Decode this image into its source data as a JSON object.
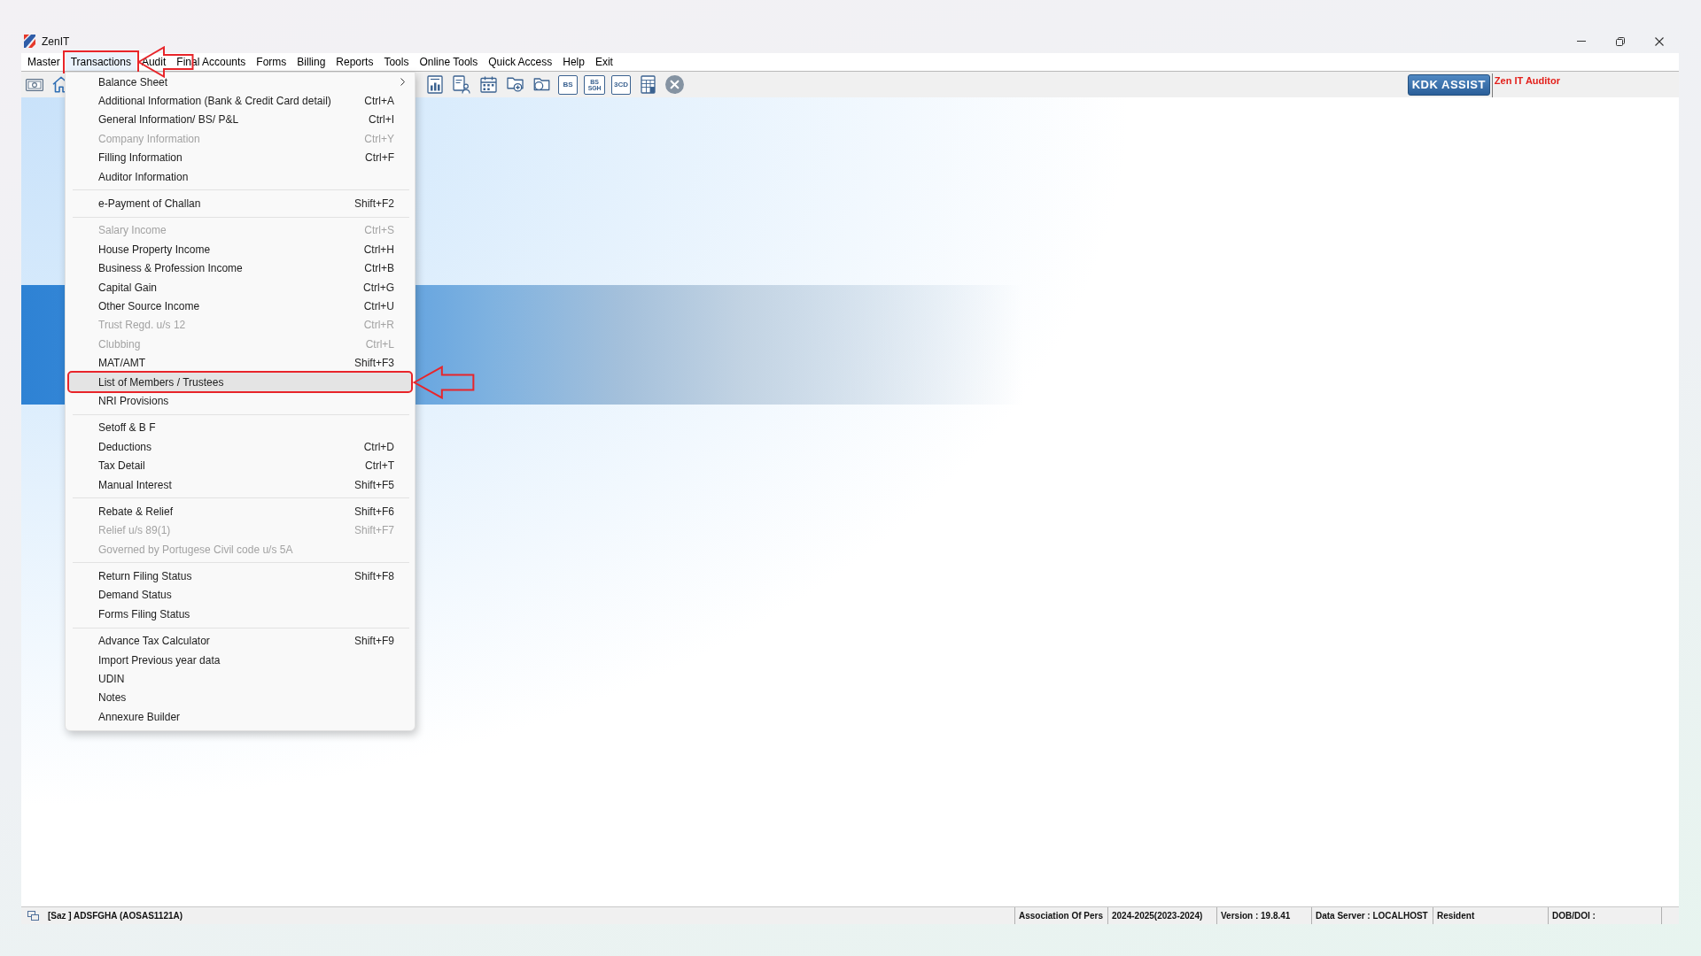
{
  "window": {
    "title": "ZenIT"
  },
  "menu_bar": [
    {
      "label": "Master",
      "selected": false,
      "callout": false
    },
    {
      "label": "Transactions",
      "selected": true,
      "callout": true
    },
    {
      "label": "Audit",
      "selected": false,
      "callout": false
    },
    {
      "label": "Final Accounts",
      "selected": false,
      "callout": false
    },
    {
      "label": "Forms",
      "selected": false,
      "callout": false
    },
    {
      "label": "Billing",
      "selected": false,
      "callout": false
    },
    {
      "label": "Reports",
      "selected": false,
      "callout": false
    },
    {
      "label": "Tools",
      "selected": false,
      "callout": false
    },
    {
      "label": "Online Tools",
      "selected": false,
      "callout": false
    },
    {
      "label": "Quick Access",
      "selected": false,
      "callout": false
    },
    {
      "label": "Help",
      "selected": false,
      "callout": false
    },
    {
      "label": "Exit",
      "selected": false,
      "callout": false
    }
  ],
  "toolbar": {
    "buttons": [
      {
        "kind": "banknote"
      },
      {
        "kind": "home"
      },
      {
        "kind": "chart-document"
      },
      {
        "kind": "user-document"
      },
      {
        "kind": "calendar"
      },
      {
        "kind": "folder-plus"
      },
      {
        "kind": "folder-circle"
      },
      {
        "kind": "text",
        "label": "BS"
      },
      {
        "kind": "text",
        "label": "BS",
        "sublabel": "SGH"
      },
      {
        "kind": "text",
        "label": "3CD"
      },
      {
        "kind": "spreadsheet"
      },
      {
        "kind": "close"
      }
    ],
    "assist_button": "KDK ASSIST",
    "product_label": "Zen IT Auditor"
  },
  "dropdown": {
    "groups": [
      [
        {
          "label": "Balance Sheet",
          "disabled": false,
          "selected": false,
          "callout": false,
          "submenu": true
        },
        {
          "label": "Additional Information (Bank & Credit Card detail)",
          "shortcut": "Ctrl+A",
          "disabled": false,
          "selected": false,
          "callout": false,
          "submenu": false
        },
        {
          "label": "General Information/ BS/ P&L",
          "shortcut": "Ctrl+I",
          "disabled": false,
          "selected": false,
          "callout": false,
          "submenu": false
        },
        {
          "label": "Company Information",
          "shortcut": "Ctrl+Y",
          "disabled": true,
          "selected": false,
          "callout": false,
          "submenu": false
        },
        {
          "label": "Filling Information",
          "shortcut": "Ctrl+F",
          "disabled": false,
          "selected": false,
          "callout": false,
          "submenu": false
        },
        {
          "label": "Auditor Information",
          "disabled": false,
          "selected": false,
          "callout": false,
          "submenu": false
        }
      ],
      [
        {
          "label": "e-Payment of Challan",
          "shortcut": "Shift+F2",
          "disabled": false,
          "selected": false,
          "callout": false,
          "submenu": false
        }
      ],
      [
        {
          "label": "Salary Income",
          "shortcut": "Ctrl+S",
          "disabled": true,
          "selected": false,
          "callout": false,
          "submenu": false
        },
        {
          "label": "House Property Income",
          "shortcut": "Ctrl+H",
          "disabled": false,
          "selected": false,
          "callout": false,
          "submenu": false
        },
        {
          "label": "Business & Profession Income",
          "shortcut": "Ctrl+B",
          "disabled": false,
          "selected": false,
          "callout": false,
          "submenu": false
        },
        {
          "label": "Capital Gain",
          "shortcut": "Ctrl+G",
          "disabled": false,
          "selected": false,
          "callout": false,
          "submenu": false
        },
        {
          "label": "Other Source Income",
          "shortcut": "Ctrl+U",
          "disabled": false,
          "selected": false,
          "callout": false,
          "submenu": false
        },
        {
          "label": "Trust Regd. u/s 12",
          "shortcut": "Ctrl+R",
          "disabled": true,
          "selected": false,
          "callout": false,
          "submenu": false
        },
        {
          "label": "Clubbing",
          "shortcut": "Ctrl+L",
          "disabled": true,
          "selected": false,
          "callout": false,
          "submenu": false
        },
        {
          "label": "MAT/AMT",
          "shortcut": "Shift+F3",
          "disabled": false,
          "selected": false,
          "callout": false,
          "submenu": false
        },
        {
          "label": "List of Members / Trustees",
          "disabled": false,
          "selected": true,
          "callout": true,
          "submenu": false
        },
        {
          "label": "NRI Provisions",
          "disabled": false,
          "selected": false,
          "callout": false,
          "submenu": false
        }
      ],
      [
        {
          "label": "Setoff & B F",
          "disabled": false,
          "selected": false,
          "callout": false,
          "submenu": false
        },
        {
          "label": "Deductions",
          "shortcut": "Ctrl+D",
          "disabled": false,
          "selected": false,
          "callout": false,
          "submenu": false
        },
        {
          "label": "Tax Detail",
          "shortcut": "Ctrl+T",
          "disabled": false,
          "selected": false,
          "callout": false,
          "submenu": false
        },
        {
          "label": "Manual Interest",
          "shortcut": "Shift+F5",
          "disabled": false,
          "selected": false,
          "callout": false,
          "submenu": false
        }
      ],
      [
        {
          "label": "Rebate & Relief",
          "shortcut": "Shift+F6",
          "disabled": false,
          "selected": false,
          "callout": false,
          "submenu": false
        },
        {
          "label": "Relief u/s 89(1)",
          "shortcut": "Shift+F7",
          "disabled": true,
          "selected": false,
          "callout": false,
          "submenu": false
        },
        {
          "label": "Governed by Portugese Civil code u/s 5A",
          "disabled": true,
          "selected": false,
          "callout": false,
          "submenu": false
        }
      ],
      [
        {
          "label": "Return Filing Status",
          "shortcut": "Shift+F8",
          "disabled": false,
          "selected": false,
          "callout": false,
          "submenu": false
        },
        {
          "label": "Demand Status",
          "disabled": false,
          "selected": false,
          "callout": false,
          "submenu": false
        },
        {
          "label": "Forms Filing Status",
          "disabled": false,
          "selected": false,
          "callout": false,
          "submenu": false
        }
      ],
      [
        {
          "label": "Advance Tax Calculator",
          "shortcut": "Shift+F9",
          "disabled": false,
          "selected": false,
          "callout": false,
          "submenu": false
        },
        {
          "label": "Import Previous year data",
          "disabled": false,
          "selected": false,
          "callout": false,
          "submenu": false
        },
        {
          "label": "UDIN",
          "disabled": false,
          "selected": false,
          "callout": false,
          "submenu": false
        },
        {
          "label": "Notes",
          "disabled": false,
          "selected": false,
          "callout": false,
          "submenu": false
        },
        {
          "label": "Annexure Builder",
          "disabled": false,
          "selected": false,
          "callout": false,
          "submenu": false
        }
      ]
    ]
  },
  "status_bar": {
    "account": "[Saz ] ADSFGHA (AOSAS1121A)",
    "panels": [
      "Association Of Pers",
      "2024-2025(2023-2024)",
      "Version : 19.8.41",
      "Data Server : LOCALHOST",
      "Resident",
      "DOB/DOI :"
    ]
  }
}
